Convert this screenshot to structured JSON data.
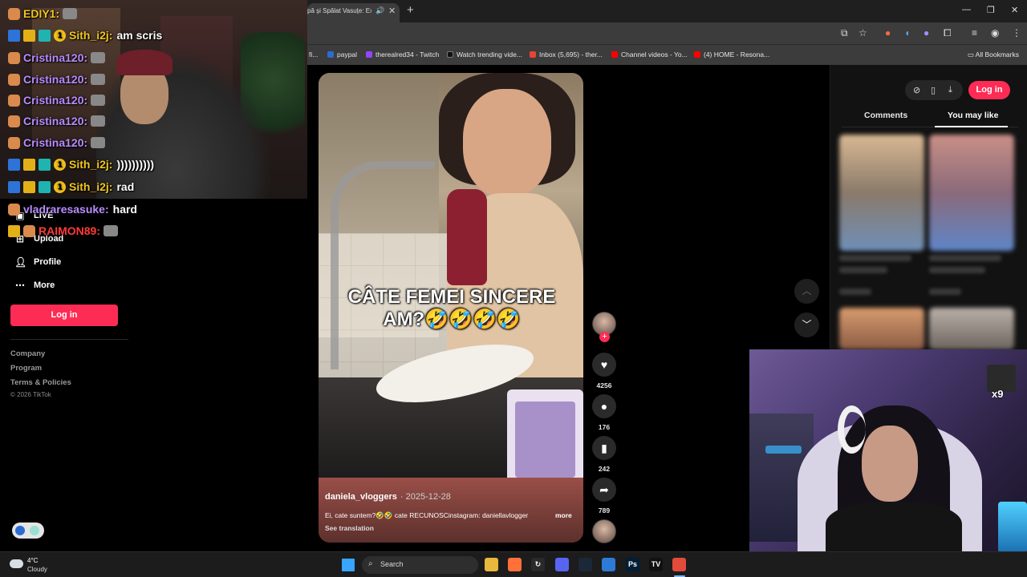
{
  "browser": {
    "tab_title": "pă și Spălat Vasuțe: Exp",
    "new_tab": "+",
    "bookmarks": [
      {
        "label": "fi...",
        "color": "#888888"
      },
      {
        "label": "paypal",
        "color": "#2b6cd1"
      },
      {
        "label": "therealred34 - Twitch",
        "color": "#9146ff"
      },
      {
        "label": "Watch trending vide...",
        "color": "#111111"
      },
      {
        "label": "Inbox (5,695) - ther...",
        "color": "#ea4335"
      },
      {
        "label": "Channel videos - Yo...",
        "color": "#ff0000"
      },
      {
        "label": "(4) HOME - Resona...",
        "color": "#ff0000"
      }
    ],
    "all_bookmarks": "All Bookmarks"
  },
  "chat": [
    {
      "badges": [
        "user"
      ],
      "nick": "EDIY1:",
      "nick_color": "nick-yellow",
      "msg": "",
      "emote": true
    },
    {
      "badges": [
        "sword",
        "crown",
        "grid",
        "coin"
      ],
      "nick": "Sith_i2j:",
      "nick_color": "nick-yellow",
      "msg": "am scris",
      "emote": false
    },
    {
      "badges": [
        "user"
      ],
      "nick": "Cristina120:",
      "nick_color": "nick-purple",
      "msg": "",
      "emote": true
    },
    {
      "badges": [
        "user"
      ],
      "nick": "Cristina120:",
      "nick_color": "nick-purple",
      "msg": "",
      "emote": true
    },
    {
      "badges": [
        "user"
      ],
      "nick": "Cristina120:",
      "nick_color": "nick-purple",
      "msg": "",
      "emote": true
    },
    {
      "badges": [
        "user"
      ],
      "nick": "Cristina120:",
      "nick_color": "nick-purple",
      "msg": "",
      "emote": true
    },
    {
      "badges": [
        "user"
      ],
      "nick": "Cristina120:",
      "nick_color": "nick-purple",
      "msg": "",
      "emote": true
    },
    {
      "badges": [
        "sword",
        "crown",
        "grid",
        "coin"
      ],
      "nick": "Sith_i2j:",
      "nick_color": "nick-yellow",
      "msg": "))))))))))",
      "emote": false
    },
    {
      "badges": [
        "sword",
        "crown",
        "grid",
        "coin"
      ],
      "nick": "Sith_i2j:",
      "nick_color": "nick-yellow",
      "msg": "rad",
      "emote": false
    },
    {
      "badges": [
        "user"
      ],
      "nick": "vladraresasuke:",
      "nick_color": "nick-purple",
      "msg": "hard",
      "emote": false
    },
    {
      "badges": [
        "crown",
        "user"
      ],
      "nick": "RAIMON89:",
      "nick_color": "nick-red",
      "msg": "",
      "emote": true
    }
  ],
  "sidebar": {
    "items": [
      {
        "label": "LIVE",
        "icon": "live-icon"
      },
      {
        "label": "Upload",
        "icon": "upload-icon"
      },
      {
        "label": "Profile",
        "icon": "profile-icon"
      },
      {
        "label": "More",
        "icon": "more-icon"
      }
    ],
    "login": "Log in",
    "footer": [
      "Company",
      "Program",
      "Terms & Policies"
    ],
    "copyright": "© 2026 TikTok"
  },
  "video": {
    "caption_line1": "CÂTE FEMEI SINCERE",
    "caption_line2": "AM?🤣🤣🤣🤣",
    "author": "daniela_vloggers",
    "date": "· 2025-12-28",
    "description": "Ei, cate suntem?🤣🤣 cate RECUNOSCinstagram: daniellavlogger",
    "more": "more",
    "see_translation": "See translation"
  },
  "actions": {
    "likes": "4256",
    "comments": "176",
    "saves": "242",
    "shares": "789"
  },
  "right_panel": {
    "login": "Log in",
    "tabs": [
      "Comments",
      "You may like"
    ]
  },
  "cam2": {
    "badge_text": "x9"
  },
  "taskbar": {
    "temperature": "4°C",
    "condition": "Cloudy",
    "search_label": "Search",
    "apps": [
      {
        "name": "file-explorer-icon",
        "glyph": "",
        "color": "#e8b93a"
      },
      {
        "name": "firefox-icon",
        "glyph": "",
        "color": "#ff7139"
      },
      {
        "name": "sync-icon",
        "glyph": "↻",
        "color": "#2a2a2a"
      },
      {
        "name": "discord-icon",
        "glyph": "",
        "color": "#5865f2"
      },
      {
        "name": "steam-icon",
        "glyph": "",
        "color": "#1b2838"
      },
      {
        "name": "app-icon",
        "glyph": "",
        "color": "#2d7bd6"
      },
      {
        "name": "photoshop-icon",
        "glyph": "Ps",
        "color": "#001e36"
      },
      {
        "name": "tradingview-icon",
        "glyph": "TV",
        "color": "#111111"
      },
      {
        "name": "chrome-icon",
        "glyph": "",
        "color": "#e24a3b"
      }
    ]
  }
}
